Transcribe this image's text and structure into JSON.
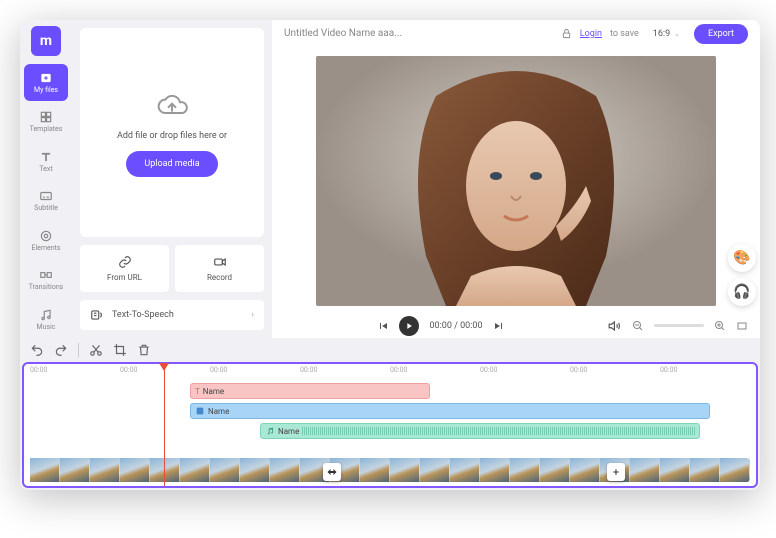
{
  "logo": "m",
  "sidebar": {
    "items": [
      {
        "label": "My files"
      },
      {
        "label": "Templates"
      },
      {
        "label": "Text"
      },
      {
        "label": "Subtitle"
      },
      {
        "label": "Elements"
      },
      {
        "label": "Transitions"
      },
      {
        "label": "Music"
      }
    ]
  },
  "drop": {
    "text": "Add file or drop files here or",
    "button": "Upload media"
  },
  "actions": {
    "from_url": "From URL",
    "record": "Record",
    "tts": "Text-To-Speech"
  },
  "header": {
    "title": "Untitled Video Name aaa...",
    "login": "Login",
    "save": "to save",
    "aspect": "16:9",
    "export": "Export"
  },
  "controls": {
    "time_current": "00:00",
    "time_total": "00:00"
  },
  "ruler": {
    "ticks": [
      "00:00",
      "00:00",
      "00:00",
      "00:00",
      "00:00",
      "00:00",
      "00:00",
      "00:00"
    ]
  },
  "tracks": {
    "text_clip": "Name",
    "shape_clip": "Name",
    "audio_clip": "Name"
  },
  "thumbnails_count": 24
}
